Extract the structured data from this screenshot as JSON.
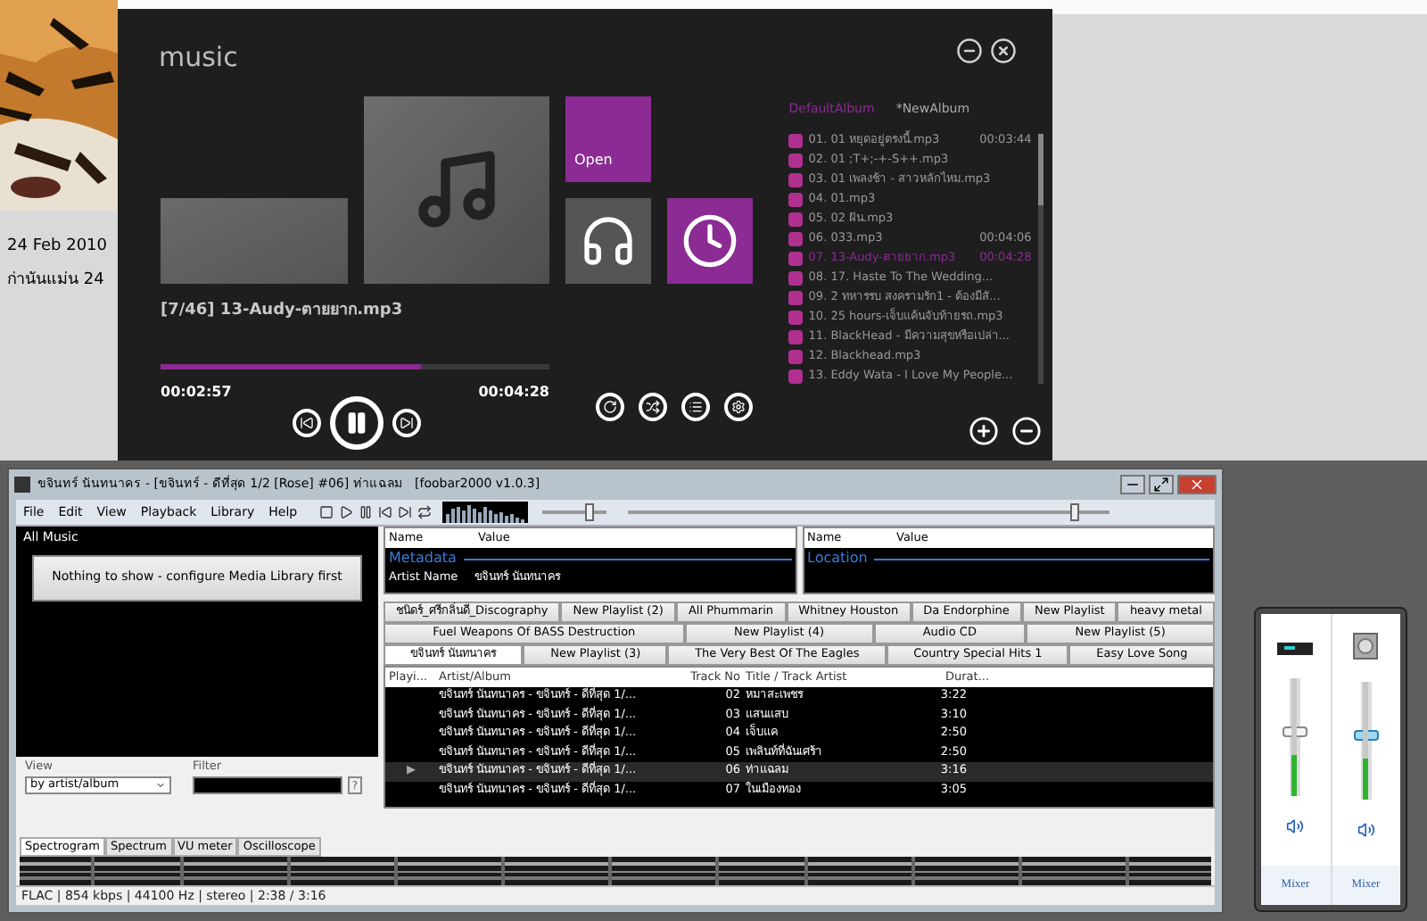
{
  "desktop": {
    "date": "24 Feb 2010",
    "caption": "ก่านันแม่น 24"
  },
  "music": {
    "title": "music",
    "tabs": [
      {
        "label": "DefaultAlbum",
        "selected": true
      },
      {
        "label": "*NewAlbum",
        "selected": false
      }
    ],
    "open_label": "Open",
    "now_playing": "[7/46] 13-Audy-ตายยาก.mp3",
    "progress": {
      "level": 0.67
    },
    "elapsed": "00:02:57",
    "total": "00:04:28",
    "playlist": [
      {
        "name": "01. 01 หยุดอยู่ตรงนี้.mp3",
        "duration": "00:03:44",
        "selected": false
      },
      {
        "name": "02. 01 ;T+;-+-S++.mp3",
        "selected": false
      },
      {
        "name": "03. 01 เพลงช้า - สาวหลักไหม.mp3",
        "selected": false
      },
      {
        "name": "04. 01.mp3",
        "selected": false
      },
      {
        "name": "05. 02 ฝัน.mp3",
        "selected": false
      },
      {
        "name": "06. 033.mp3",
        "duration": "00:04:06",
        "selected": false
      },
      {
        "name": "07. 13-Audy-ตายยาก.mp3",
        "duration": "00:04:28",
        "selected": true
      },
      {
        "name": "08. 17. Haste To The Wedding...",
        "selected": false
      },
      {
        "name": "09. 2 ทหารรบ สงครามรัก1 - ต้องมีสั...",
        "selected": false
      },
      {
        "name": "10. 25 hours-เจ็บแค้นจับท้ายรถ.mp3",
        "selected": false
      },
      {
        "name": "11. BlackHead - มีความสุขหรือเปล่า...",
        "selected": false
      },
      {
        "name": "12. Blackhead.mp3",
        "selected": false
      },
      {
        "name": "13. Eddy Wata - I Love My People...",
        "selected": false
      }
    ]
  },
  "foobar": {
    "title": "ขจินทร์ นันทนาคร - [ขจินทร์ - ดีที่สุด 1/2 [Rose] #06] ท่าแฉลม   [foobar2000 v1.0.3]",
    "menu": [
      "File",
      "Edit",
      "View",
      "Playback",
      "Library",
      "Help"
    ],
    "volume": {
      "level": 0.75
    },
    "seek": {
      "level": 0.93
    },
    "library": {
      "title": "All Music",
      "message": "Nothing to show - configure Media Library first",
      "view_label": "View",
      "view_value": "by artist/album",
      "filter_label": "Filter",
      "help_button": "?"
    },
    "properties": [
      {
        "columns": [
          "Name",
          "Value"
        ],
        "section": "Metadata",
        "rows": [
          {
            "name": "Artist Name",
            "value": "ขจินทร์ นันทนาคร"
          }
        ]
      },
      {
        "columns": [
          "Name",
          "Value"
        ],
        "section": "Location"
      }
    ],
    "playlist_tabs": [
      [
        {
          "label": "ชนิดร์_ศรีกลิ่นดี_Discography",
          "selected": false
        },
        {
          "label": "New Playlist (2)",
          "selected": false
        },
        {
          "label": "All Phummarin",
          "selected": false
        },
        {
          "label": "Whitney Houston",
          "selected": false
        },
        {
          "label": "Da Endorphine",
          "selected": false
        },
        {
          "label": "New Playlist",
          "selected": false
        },
        {
          "label": "heavy metal",
          "selected": false
        }
      ],
      [
        {
          "label": "Fuel Weapons Of BASS Destruction",
          "selected": false
        },
        {
          "label": "New Playlist (4)",
          "selected": false
        },
        {
          "label": "Audio CD",
          "selected": false
        },
        {
          "label": "New Playlist (5)",
          "selected": false
        }
      ],
      [
        {
          "label": "ขจินทร์ นันทนาคร",
          "selected": true
        },
        {
          "label": "New Playlist (3)",
          "selected": false
        },
        {
          "label": "The Very Best Of The Eagles",
          "selected": false
        },
        {
          "label": "Country Special Hits 1",
          "selected": false
        },
        {
          "label": "Easy Love Song",
          "selected": false
        }
      ]
    ],
    "columns": [
      "Playi...",
      "Artist/Album",
      "Track No",
      "Title / Track Artist",
      "Durat..."
    ],
    "rows": [
      {
        "playing": "",
        "artist": "ขจินทร์ นันทนาคร - ขจินทร์ - ดีที่สุด 1/...",
        "track": "02",
        "title": "หมาสะเพชร",
        "duration": "3:22",
        "selected": false
      },
      {
        "playing": "",
        "artist": "ขจินทร์ นันทนาคร - ขจินทร์ - ดีที่สุด 1/...",
        "track": "03",
        "title": "แสนแสบ",
        "duration": "3:10",
        "selected": false
      },
      {
        "playing": "",
        "artist": "ขจินทร์ นันทนาคร - ขจินทร์ - ดีที่สุด 1/...",
        "track": "04",
        "title": "เจ็บแค",
        "duration": "2:50",
        "selected": false
      },
      {
        "playing": "",
        "artist": "ขจินทร์ นันทนาคร - ขจินทร์ - ดีที่สุด 1/...",
        "track": "05",
        "title": "เพลินท์ที่ฉันเศร้า",
        "duration": "2:50",
        "selected": false
      },
      {
        "playing": "▶",
        "artist": "ขจินทร์ นันทนาคร - ขจินทร์ - ดีที่สุด 1/...",
        "track": "06",
        "title": "ท่าแฉลม",
        "duration": "3:16",
        "selected": true
      },
      {
        "playing": "",
        "artist": "ขจินทร์ นันทนาคร - ขจินทร์ - ดีที่สุด 1/...",
        "track": "07",
        "title": "ในเมืองทอง",
        "duration": "3:05",
        "selected": false
      }
    ],
    "vis_tabs": [
      {
        "label": "Spectrogram",
        "selected": true
      },
      {
        "label": "Spectrum",
        "selected": false
      },
      {
        "label": "VU meter",
        "selected": false
      },
      {
        "label": "Oscilloscope",
        "selected": false
      }
    ],
    "status": "FLAC | 854 kbps | 44100 Hz | stereo | 2:38 / 3:16"
  },
  "mixer": {
    "channels": [
      {
        "kind": "device",
        "level": 0.55,
        "meter": {
          "level": 0.35
        },
        "label": "Mixer",
        "focused": false
      },
      {
        "kind": "speaker",
        "level": 0.55,
        "meter": {
          "level": 0.35
        },
        "label": "Mixer",
        "focused": true
      }
    ]
  }
}
